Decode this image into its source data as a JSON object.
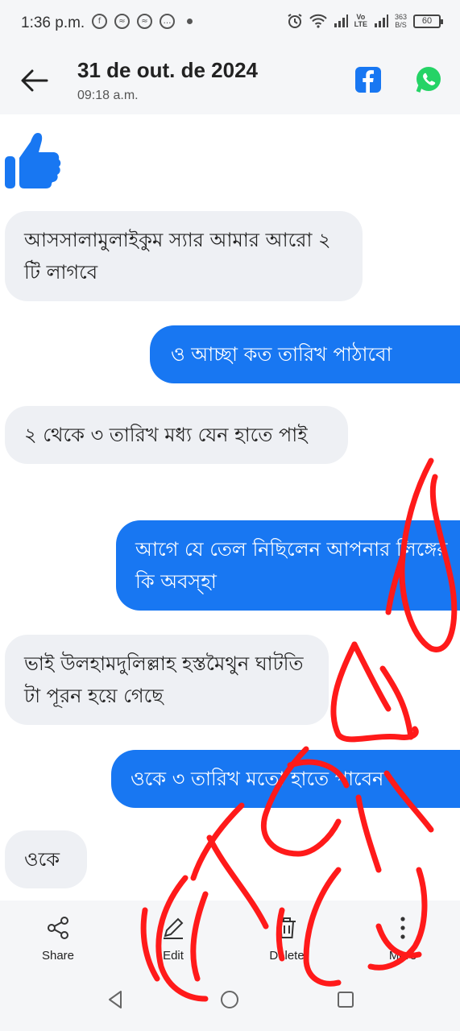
{
  "status_bar": {
    "time": "1:36 p.m.",
    "volte_top": "Vo",
    "volte_bottom": "LTE",
    "net_speed_value": "363",
    "net_speed_unit": "B/S",
    "battery": "60",
    "icons": [
      "facebook-icon",
      "messenger-icon",
      "messenger-icon",
      "sms-icon",
      "dot-icon",
      "alarm-icon",
      "wifi-icon",
      "signal-icon",
      "signal-icon"
    ]
  },
  "header": {
    "date": "31 de out. de 2024",
    "time": "09:18 a.m.",
    "icons": [
      "back-arrow-icon",
      "facebook-icon",
      "whatsapp-icon"
    ]
  },
  "messages": [
    {
      "side": "in",
      "type": "like-emoji"
    },
    {
      "side": "in",
      "text": "আসসালামুলাইকুম  স্যার আমার আরো ২ টি লাগবে"
    },
    {
      "side": "out",
      "text": "ও আচ্ছা কত তারিখ পাঠাবো"
    },
    {
      "side": "in",
      "text": "২ থেকে ৩ তারিখ মধ্য যেন হাতে পাই"
    },
    {
      "side": "out",
      "text": "আগে যে তেল নিছিলেন আপনার লিঙ্গের কি অবস্হা"
    },
    {
      "side": "in",
      "text": "ভাই উলহামদুলিল্লাহ হস্তমৈথুন ঘাটতি টা পূরন হয়ে গেছে"
    },
    {
      "side": "out",
      "text": "ওকে  ৩ তারিখ মতো হাতে পাবেন"
    },
    {
      "side": "in",
      "text": "ওকে"
    }
  ],
  "actions": [
    {
      "label": "Share",
      "icon": "share-icon"
    },
    {
      "label": "Edit",
      "icon": "edit-icon"
    },
    {
      "label": "Delete",
      "icon": "trash-icon"
    },
    {
      "label": "More",
      "icon": "more-vertical-icon"
    }
  ],
  "nav": [
    "nav-back-icon",
    "nav-home-icon",
    "nav-recents-icon"
  ],
  "colors": {
    "accent": "#1877f2",
    "incoming_bubble": "#eef0f4",
    "bar_background": "#f5f6f8",
    "scribble": "#ff1a1a",
    "whatsapp": "#25d366"
  }
}
